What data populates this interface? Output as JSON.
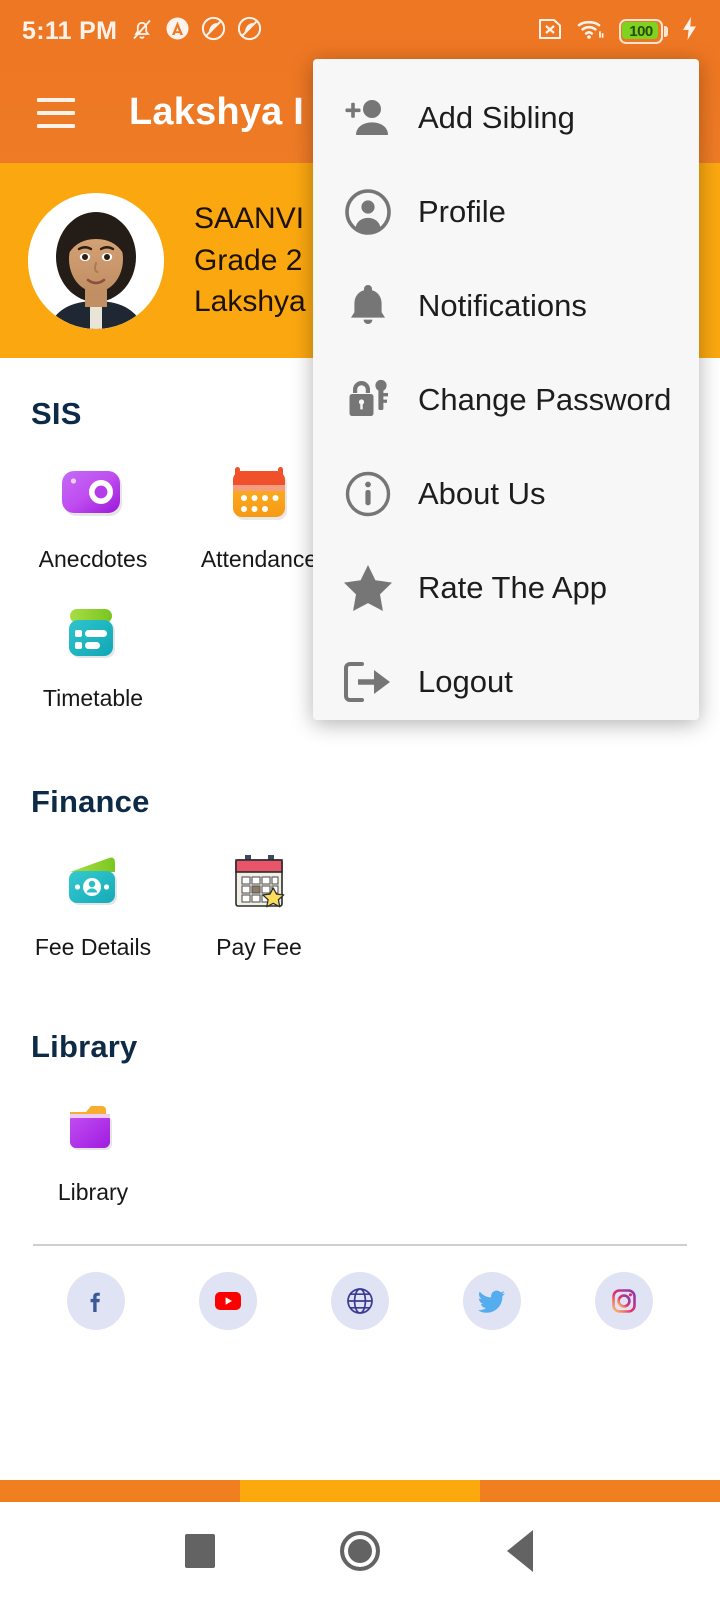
{
  "status_bar": {
    "time": "5:11 PM",
    "left_icons": [
      "bell-off-icon",
      "adblock-icon",
      "dnd-icon",
      "dnd-icon"
    ],
    "right_icons": [
      "sim-missing-icon",
      "wifi-icon"
    ],
    "battery_percent": "100",
    "charging_icon": "lightning-bolt-icon",
    "battery_fill_color": "#7ed321",
    "background_color": "#ee7723"
  },
  "app_bar": {
    "menu_icon": "hamburger-icon",
    "title": "Lakshya I",
    "background_color": "#ee7723"
  },
  "student_card": {
    "avatar": "student-photo",
    "name": "SAANVI",
    "grade": "Grade 2",
    "school": "Lakshya",
    "background_color": "#fba810"
  },
  "overflow_menu": {
    "background_color": "#f7f7f7",
    "items": [
      {
        "label": "Add Sibling",
        "icon": "person-add-icon"
      },
      {
        "label": "Profile",
        "icon": "account-circle-icon"
      },
      {
        "label": "Notifications",
        "icon": "bell-icon"
      },
      {
        "label": "Change Password",
        "icon": "lock-key-icon"
      },
      {
        "label": "About Us",
        "icon": "info-circle-icon"
      },
      {
        "label": "Rate The App",
        "icon": "star-icon"
      },
      {
        "label": "Logout",
        "icon": "logout-arrow-icon"
      }
    ]
  },
  "sections": [
    {
      "title": "SIS",
      "tiles": [
        {
          "label": "Anecdotes",
          "icon": "camera-icon"
        },
        {
          "label": "Attendance",
          "icon": "calendar-icon"
        },
        {
          "label": "Timetable",
          "icon": "timetable-icon"
        }
      ]
    },
    {
      "title": "Finance",
      "tiles": [
        {
          "label": "Fee Details",
          "icon": "wallet-icon"
        },
        {
          "label": "Pay Fee",
          "icon": "calendar-star-icon"
        }
      ]
    },
    {
      "title": "Library",
      "tiles": [
        {
          "label": "Library",
          "icon": "folder-icon"
        }
      ]
    }
  ],
  "social_links": [
    {
      "name": "facebook-icon",
      "color": "#3b5998"
    },
    {
      "name": "youtube-icon",
      "color": "#ff0000"
    },
    {
      "name": "website-icon",
      "color": "#3b3b8f"
    },
    {
      "name": "twitter-icon",
      "color": "#55acee"
    },
    {
      "name": "instagram-icon",
      "color": "#e1306c"
    }
  ],
  "bottom_strip": {
    "segment_colors": [
      "#f0801f",
      "#fca90d",
      "#f0801f"
    ]
  },
  "system_nav": {
    "buttons": [
      {
        "name": "recents-button",
        "icon": "square-icon"
      },
      {
        "name": "home-button",
        "icon": "circle-icon"
      },
      {
        "name": "back-button",
        "icon": "triangle-left-icon"
      }
    ]
  },
  "theme": {
    "header_orange": "#ee7723",
    "card_amber": "#fba810",
    "section_title_navy": "#0d2b47"
  }
}
